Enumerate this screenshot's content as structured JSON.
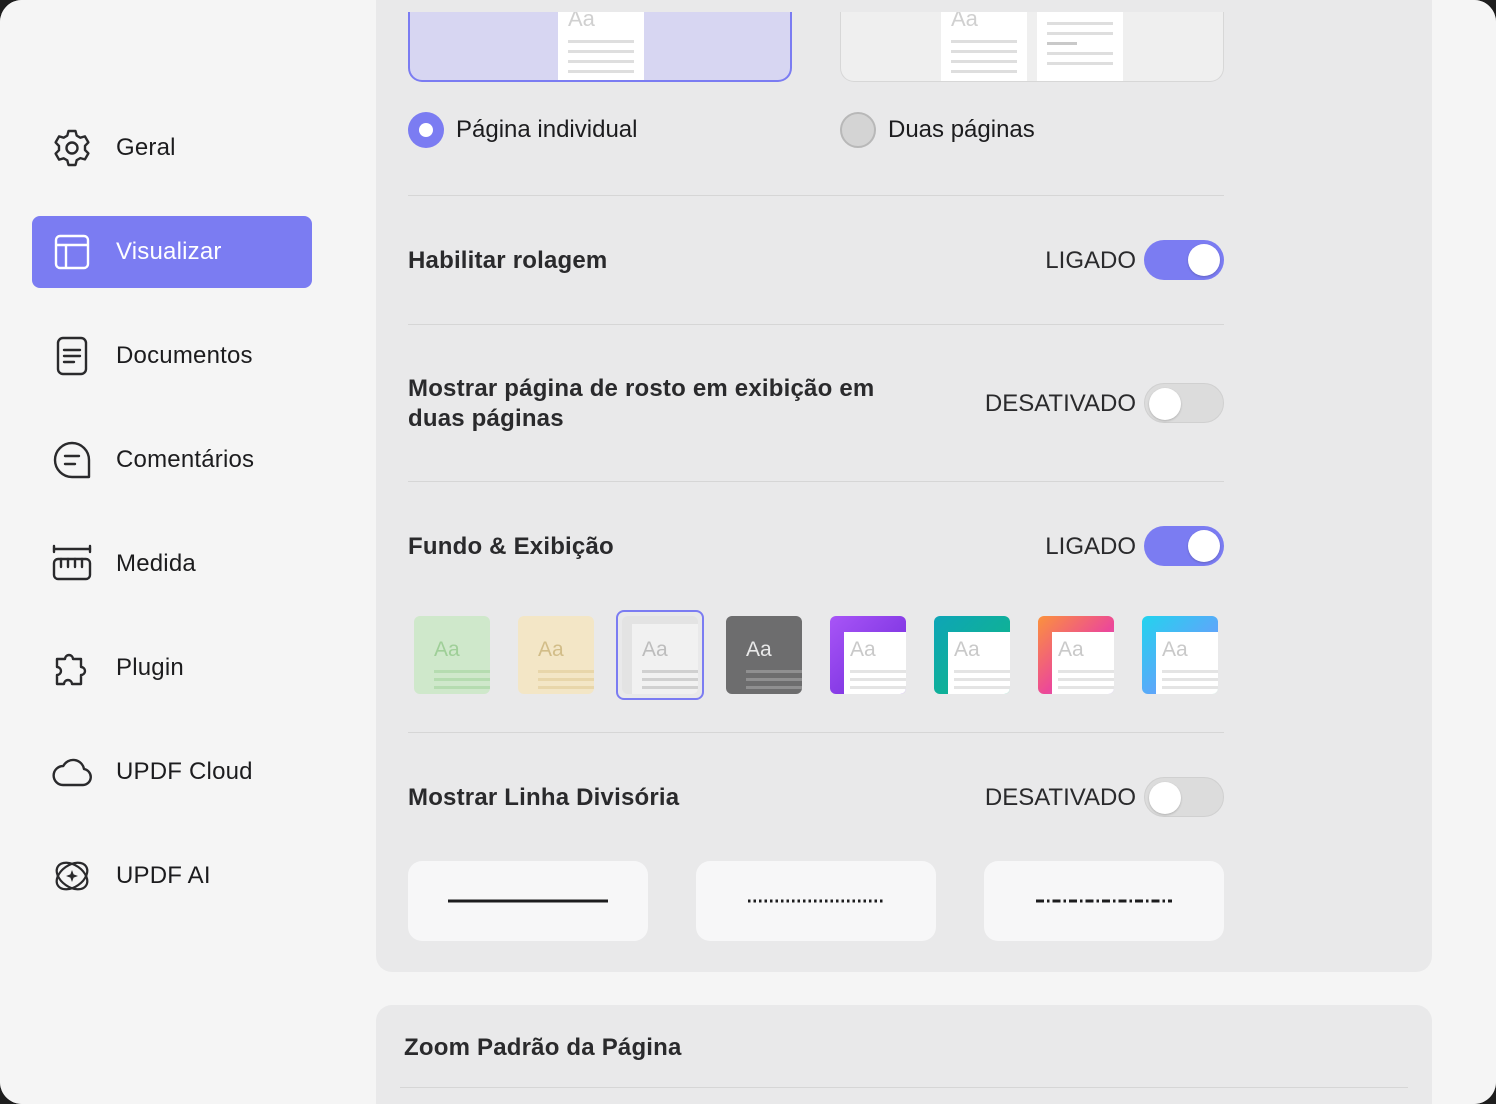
{
  "window": {
    "traffic_lights": [
      "close",
      "minimize",
      "maximize"
    ]
  },
  "sidebar": {
    "items": [
      {
        "label": "Geral",
        "icon": "gear-icon",
        "active": false
      },
      {
        "label": "Visualizar",
        "icon": "layout-icon",
        "active": true
      },
      {
        "label": "Documentos",
        "icon": "document-icon",
        "active": false
      },
      {
        "label": "Comentários",
        "icon": "comment-icon",
        "active": false
      },
      {
        "label": "Medida",
        "icon": "ruler-icon",
        "active": false
      },
      {
        "label": "Plugin",
        "icon": "puzzle-icon",
        "active": false
      },
      {
        "label": "UPDF Cloud",
        "icon": "cloud-icon",
        "active": false
      },
      {
        "label": "UPDF AI",
        "icon": "ai-icon",
        "active": false
      }
    ]
  },
  "page_layout": {
    "thumb_text": "Aa",
    "options": [
      {
        "label": "Página individual",
        "selected": true
      },
      {
        "label": "Duas páginas",
        "selected": false
      }
    ]
  },
  "settings": {
    "scroll": {
      "label": "Habilitar rolagem",
      "state": "LIGADO",
      "on": true
    },
    "cover": {
      "label": "Mostrar página de rosto em exibição em duas páginas",
      "state": "DESATIVADO",
      "on": false
    },
    "background": {
      "label": "Fundo & Exibição",
      "state": "LIGADO",
      "on": true
    },
    "divider_line": {
      "label": "Mostrar Linha Divisória",
      "state": "DESATIVADO",
      "on": false
    }
  },
  "background_themes": {
    "sample_text": "Aa",
    "selected_index": 2,
    "themes": [
      {
        "name": "green",
        "bg": "#cfe8cb",
        "line": "#b5dcb0",
        "text": "#9fcf98"
      },
      {
        "name": "sepia",
        "bg": "#f3e6c6",
        "line": "#e8d6aa",
        "text": "#d2bd88"
      },
      {
        "name": "light-gray",
        "bg": "#e3e3e3",
        "line": "#c8c8c8",
        "text": "#bdbdbd"
      },
      {
        "name": "dark",
        "bg": "#6d6d6e",
        "line": "#8f8f90",
        "text": "#e9e9e9"
      },
      {
        "name": "purple",
        "accent": "#7c3aed"
      },
      {
        "name": "teal",
        "accent": "#11a7a6"
      },
      {
        "name": "sunset",
        "accent": "#f07167"
      },
      {
        "name": "sky",
        "accent": "#38bdf8"
      }
    ]
  },
  "divider_styles": [
    "solid",
    "dotted",
    "dash-dot"
  ],
  "zoom": {
    "title": "Zoom Padrão da Página"
  },
  "colors": {
    "accent": "#7b7cf2"
  }
}
